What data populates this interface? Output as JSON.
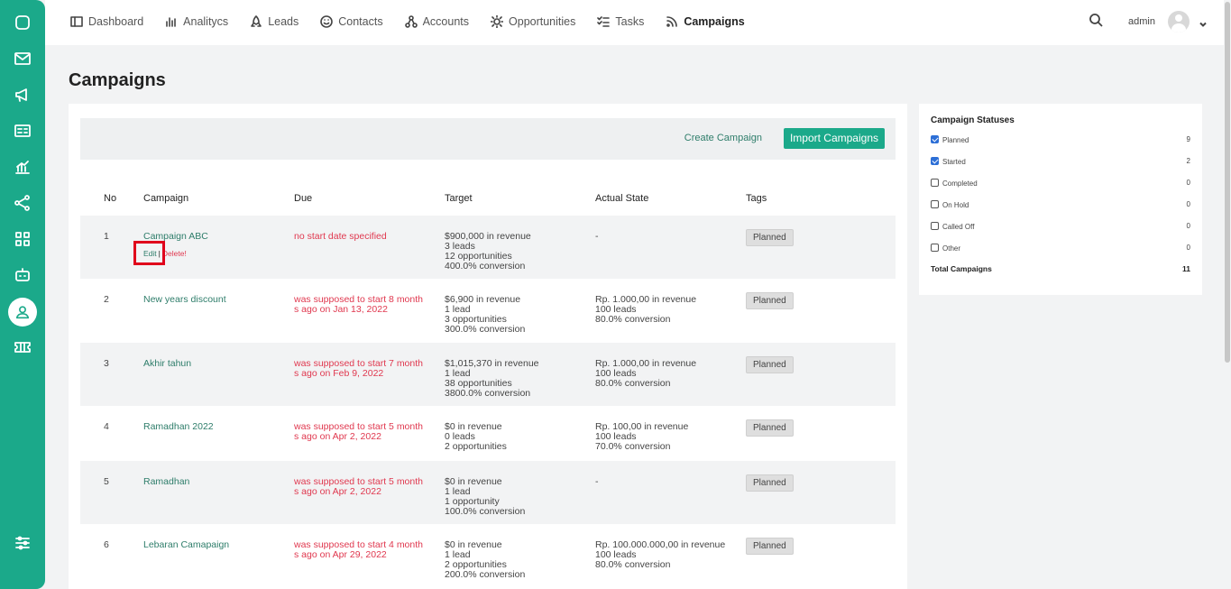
{
  "rail": {
    "items": [
      "inbox-icon",
      "mail-icon",
      "megaphone-icon",
      "id-card-icon",
      "analytics-icon",
      "share-icon",
      "grid-icon",
      "robot-icon",
      "user-icon",
      "ticket-icon",
      "settings-sliders-icon"
    ],
    "active": "user-icon",
    "color": "#1ba98a"
  },
  "nav": {
    "items": [
      {
        "label": "Dashboard",
        "icon": "dashboard-icon"
      },
      {
        "label": "Analitycs",
        "icon": "bar-chart-icon"
      },
      {
        "label": "Leads",
        "icon": "rocket-icon"
      },
      {
        "label": "Contacts",
        "icon": "smile-icon"
      },
      {
        "label": "Accounts",
        "icon": "accounts-icon"
      },
      {
        "label": "Opportunities",
        "icon": "sun-icon"
      },
      {
        "label": "Tasks",
        "icon": "tasks-icon"
      },
      {
        "label": "Campaigns",
        "icon": "rss-icon"
      }
    ],
    "active": "Campaigns"
  },
  "user": {
    "name": "admin"
  },
  "page": {
    "title": "Campaigns"
  },
  "actions": {
    "create": "Create Campaign",
    "import": "Import Campaigns"
  },
  "table": {
    "headers": [
      "No",
      "Campaign",
      "Due",
      "Target",
      "Actual State",
      "Tags"
    ],
    "row_actions": {
      "edit": "Edit",
      "separator": "|",
      "delete": "Delete!"
    },
    "rows": [
      {
        "no": "1",
        "campaign": "Campaign ABC",
        "due": "no start date specified",
        "target": [
          "$900,000 in revenue",
          "3 leads",
          "12 opportunities",
          "400.0% conversion"
        ],
        "actual": [
          "-"
        ],
        "tag": "Planned"
      },
      {
        "no": "2",
        "campaign": "New years discount",
        "due": "was supposed to start 8 months ago on Jan 13, 2022",
        "target": [
          "$6,900 in revenue",
          "1 lead",
          "3 opportunities",
          "300.0% conversion"
        ],
        "actual": [
          "Rp. 1.000,00 in revenue",
          "100 leads",
          "80.0% conversion"
        ],
        "tag": "Planned"
      },
      {
        "no": "3",
        "campaign": "Akhir tahun",
        "due": "was supposed to start 7 months ago on Feb 9, 2022",
        "target": [
          "$1,015,370 in revenue",
          "1 lead",
          "38 opportunities",
          "3800.0% conversion"
        ],
        "actual": [
          "Rp. 1.000,00 in revenue",
          "100 leads",
          "80.0% conversion"
        ],
        "tag": "Planned"
      },
      {
        "no": "4",
        "campaign": "Ramadhan 2022",
        "due": "was supposed to start 5 months ago on Apr 2, 2022",
        "target": [
          "$0 in revenue",
          "0 leads",
          "2 opportunities"
        ],
        "actual": [
          "Rp. 100,00 in revenue",
          "100 leads",
          "70.0% conversion"
        ],
        "tag": "Planned"
      },
      {
        "no": "5",
        "campaign": "Ramadhan",
        "due": "was supposed to start 5 months ago on Apr 2, 2022",
        "target": [
          "$0 in revenue",
          "1 lead",
          "1 opportunity",
          "100.0% conversion"
        ],
        "actual": [
          "-"
        ],
        "tag": "Planned"
      },
      {
        "no": "6",
        "campaign": "Lebaran Camapaign",
        "due": "was supposed to start 4 months ago on Apr 29, 2022",
        "target": [
          "$0 in revenue",
          "1 lead",
          "2 opportunities",
          "200.0% conversion"
        ],
        "actual": [
          "Rp. 100.000.000,00 in revenue",
          "100 leads",
          "80.0% conversion"
        ],
        "tag": "Planned"
      }
    ]
  },
  "statuses": {
    "title": "Campaign Statuses",
    "items": [
      {
        "label": "Planned",
        "count": "9",
        "checked": true
      },
      {
        "label": "Started",
        "count": "2",
        "checked": true
      },
      {
        "label": "Completed",
        "count": "0",
        "checked": false
      },
      {
        "label": "On Hold",
        "count": "0",
        "checked": false
      },
      {
        "label": "Called Off",
        "count": "0",
        "checked": false
      },
      {
        "label": "Other",
        "count": "0",
        "checked": false
      }
    ],
    "total_label": "Total Campaigns",
    "total_count": "11"
  }
}
